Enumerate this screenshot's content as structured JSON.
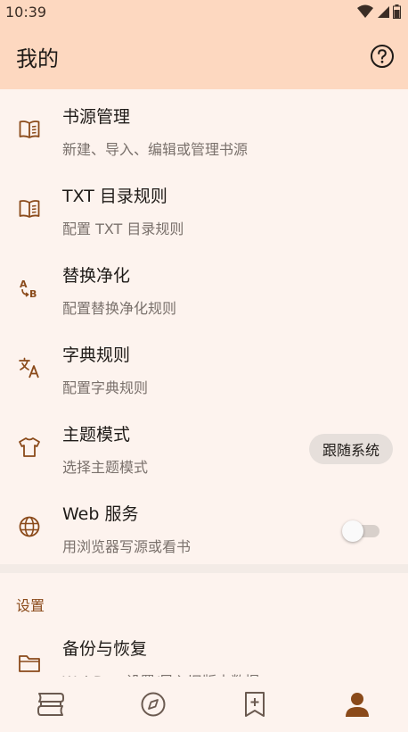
{
  "status": {
    "time": "10:39"
  },
  "appbar": {
    "title": "我的"
  },
  "items": [
    {
      "title": "书源管理",
      "subtitle": "新建、导入、编辑或管理书源"
    },
    {
      "title": "TXT 目录规则",
      "subtitle": "配置 TXT 目录规则"
    },
    {
      "title": "替换净化",
      "subtitle": "配置替换净化规则"
    },
    {
      "title": "字典规则",
      "subtitle": "配置字典规则"
    },
    {
      "title": "主题模式",
      "subtitle": "选择主题模式",
      "value": "跟随系统"
    },
    {
      "title": "Web 服务",
      "subtitle": "用浏览器写源或看书",
      "toggle": false
    }
  ],
  "section": {
    "label": "设置"
  },
  "backup": {
    "title": "备份与恢复",
    "subtitle": "WebDav 设置/导入旧版本数据"
  },
  "colors": {
    "accent": "#8a4a1a",
    "header": "#fdd8c0",
    "background": "#fdf3ee"
  }
}
